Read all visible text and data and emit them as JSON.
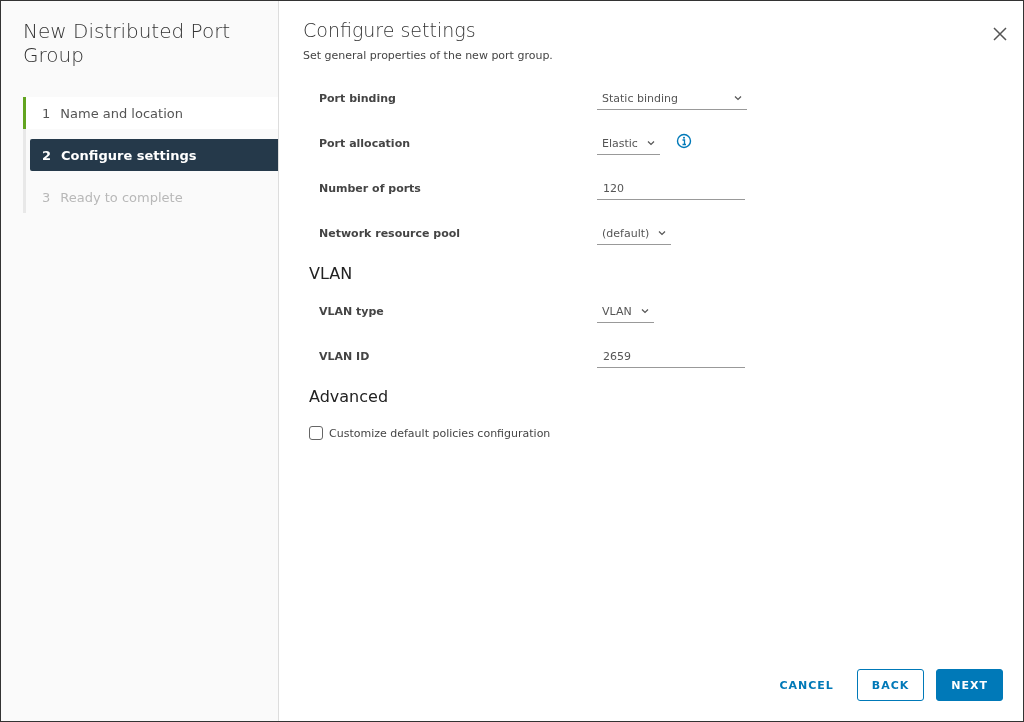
{
  "wizard": {
    "title": "New Distributed Port Group"
  },
  "steps": [
    {
      "number": "1",
      "label": "Name and location",
      "selected": false,
      "completed": true,
      "disabled": false
    },
    {
      "number": "2",
      "label": "Configure settings",
      "selected": true,
      "completed": false,
      "disabled": false
    },
    {
      "number": "3",
      "label": "Ready to complete",
      "selected": false,
      "completed": false,
      "disabled": true
    }
  ],
  "page": {
    "title": "Configure settings",
    "subtitle": "Set general properties of the new port group."
  },
  "sections": [
    {
      "fields": [
        {
          "label": "Port binding",
          "kind": "select",
          "value": "Static binding",
          "info": false
        },
        {
          "label": "Port allocation",
          "kind": "select",
          "value": "Elastic",
          "info": true
        },
        {
          "label": "Number of ports",
          "kind": "input",
          "value": "120",
          "info": false
        },
        {
          "label": "Network resource pool",
          "kind": "select",
          "value": "(default)",
          "info": false
        }
      ]
    },
    {
      "heading": "VLAN",
      "fields": [
        {
          "label": "VLAN type",
          "kind": "select",
          "value": "VLAN",
          "info": false
        },
        {
          "label": "VLAN ID",
          "kind": "input",
          "value": "2659",
          "info": false
        }
      ]
    },
    {
      "heading": "Advanced",
      "checkbox": {
        "label": "Customize default policies configuration",
        "checked": false
      }
    }
  ],
  "buttons": [
    {
      "label": "CANCEL",
      "kind": "flat"
    },
    {
      "label": "BACK",
      "kind": "outline"
    },
    {
      "label": "NEXT",
      "kind": "primary"
    }
  ]
}
